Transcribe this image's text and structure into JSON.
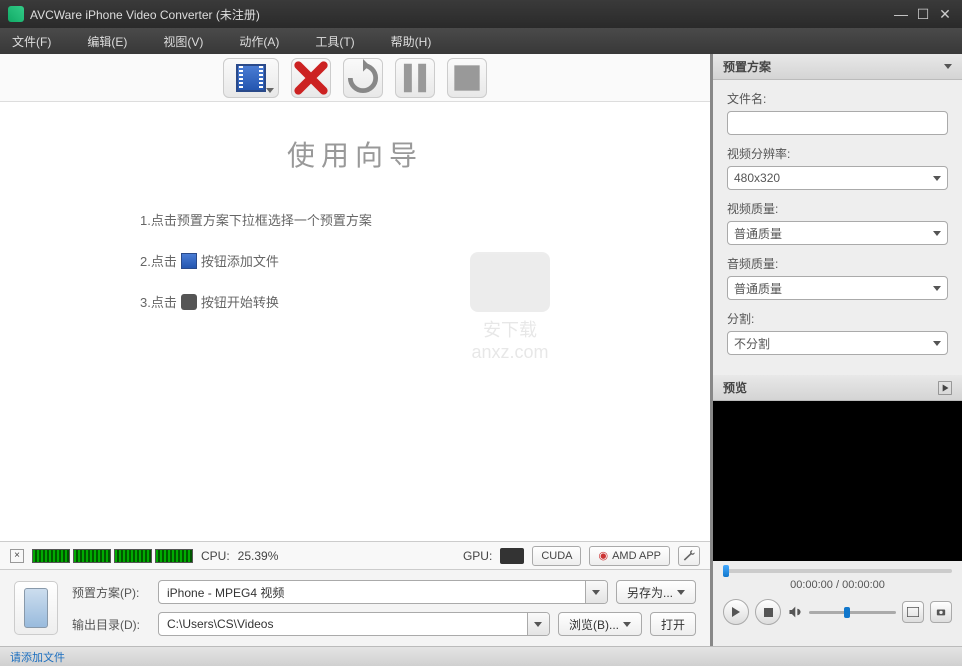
{
  "window": {
    "title": "AVCWare iPhone Video Converter (未注册)"
  },
  "menu": {
    "file": "文件(F)",
    "edit": "编辑(E)",
    "view": "视图(V)",
    "action": "动作(A)",
    "tool": "工具(T)",
    "help": "帮助(H)"
  },
  "wizard": {
    "heading": "使用向导",
    "step1": "1.点击预置方案下拉框选择一个预置方案",
    "step2a": "2.点击",
    "step2b": "按钮添加文件",
    "step3a": "3.点击",
    "step3b": "按钮开始转换"
  },
  "watermark": {
    "line1": "安下载",
    "line2": "anxz.com"
  },
  "perf": {
    "cpu_label": "CPU:",
    "cpu_value": "25.39%",
    "gpu_label": "GPU:",
    "cuda": "CUDA",
    "amd": "AMD APP"
  },
  "output": {
    "profile_label": "预置方案(P):",
    "profile_value": "iPhone - MPEG4 视频",
    "saveas": "另存为...",
    "dest_label": "输出目录(D):",
    "dest_value": "C:\\Users\\CS\\Videos",
    "browse": "浏览(B)...",
    "open": "打开"
  },
  "side": {
    "profile_hdr": "预置方案",
    "filename": "文件名:",
    "res_label": "视频分辨率:",
    "res_value": "480x320",
    "vq_label": "视频质量:",
    "vq_value": "普通质量",
    "aq_label": "音频质量:",
    "aq_value": "普通质量",
    "split_label": "分割:",
    "split_value": "不分割",
    "preview_hdr": "预览"
  },
  "player": {
    "time": "00:00:00 / 00:00:00"
  },
  "status": {
    "msg": "请添加文件"
  }
}
